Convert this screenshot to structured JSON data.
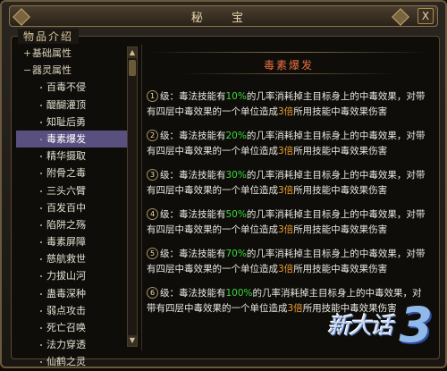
{
  "window": {
    "title": "秘 宝",
    "close_label": "X"
  },
  "section_label": "物品介绍",
  "tree": {
    "categories": [
      {
        "sign": "+",
        "label": "基础属性"
      },
      {
        "sign": "−",
        "label": "器灵属性"
      }
    ],
    "items": [
      "百毒不侵",
      "醍醐灌顶",
      "知耻后勇",
      "毒素爆发",
      "精华摄取",
      "附骨之毒",
      "三头六臂",
      "百发百中",
      "陷阱之殇",
      "毒素屏障",
      "慈航救世",
      "力拔山河",
      "蛊毒深种",
      "弱点攻击",
      "死亡召唤",
      "法力穿透",
      "仙鹤之灵"
    ],
    "selected_index": 3
  },
  "detail": {
    "header": "毒素爆发",
    "levels": [
      {
        "n": "1",
        "prefix": "级：毒法技能有",
        "pct": "10%",
        "mid": "的几率消耗掉主目标身上的中毒效果，对带有四层中毒效果的一个单位造成",
        "mult": "3倍",
        "suffix": "所用技能中毒效果伤害"
      },
      {
        "n": "2",
        "prefix": "级：毒法技能有",
        "pct": "20%",
        "mid": "的几率消耗掉主目标身上的中毒效果，对带有四层中毒效果的一个单位造成",
        "mult": "3倍",
        "suffix": "所用技能中毒效果伤害"
      },
      {
        "n": "3",
        "prefix": "级：毒法技能有",
        "pct": "30%",
        "mid": "的几率消耗掉主目标身上的中毒效果，对带有四层中毒效果的一个单位造成",
        "mult": "3倍",
        "suffix": "所用技能中毒效果伤害"
      },
      {
        "n": "4",
        "prefix": "级：毒法技能有",
        "pct": "50%",
        "mid": "的几率消耗掉主目标身上的中毒效果，对带有四层中毒效果的一个单位造成",
        "mult": "3倍",
        "suffix": "所用技能中毒效果伤害"
      },
      {
        "n": "5",
        "prefix": "级：毒法技能有",
        "pct": "70%",
        "mid": "的几率消耗掉主目标身上的中毒效果，对带有四层中毒效果的一个单位造成",
        "mult": "3倍",
        "suffix": "所用技能中毒效果伤害"
      },
      {
        "n": "6",
        "prefix": "级：毒法技能有",
        "pct": "100%",
        "mid": "的几率消耗掉主目标身上的中毒效果，对带有四层中毒效果的一个单位造成",
        "mult": "3倍",
        "suffix": "所用技能中毒效果伤害"
      }
    ]
  },
  "watermark": {
    "text": "新大话",
    "number": "3"
  },
  "colors": {
    "accent_percent": "#38d838",
    "accent_multiplier": "#f0a030",
    "header": "#e87040",
    "selected_row": "#5a5080"
  }
}
